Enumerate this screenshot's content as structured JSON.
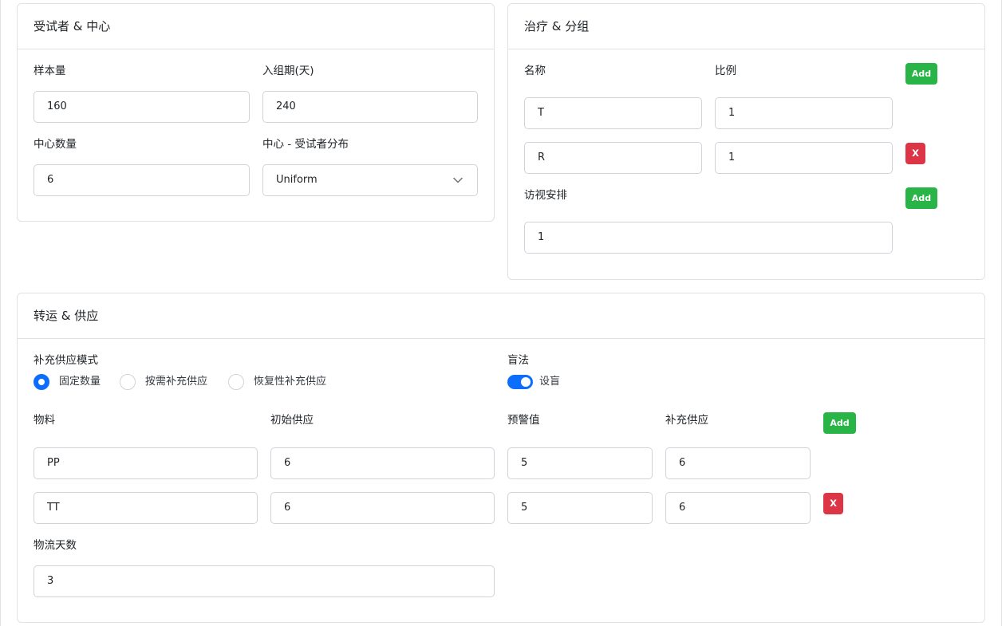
{
  "subjects_card": {
    "title": "受试者 & 中心",
    "sample_size": {
      "label": "样本量",
      "value": "160"
    },
    "enrollment_period": {
      "label": "入组期(天)",
      "value": "240"
    },
    "center_count": {
      "label": "中心数量",
      "value": "6"
    },
    "distribution": {
      "label": "中心 - 受试者分布",
      "value": "Uniform"
    }
  },
  "treatment_card": {
    "title": "治疗 & 分组",
    "name_header": "名称",
    "ratio_header": "比例",
    "add_label": "Add",
    "groups": [
      {
        "name": "T",
        "ratio": "1"
      },
      {
        "name": "R",
        "ratio": "1"
      }
    ],
    "remove_label": "X",
    "visits": {
      "label": "访视安排",
      "add_label": "Add",
      "value": "1"
    }
  },
  "supply_card": {
    "title": "转运 & 供应",
    "mode_label": "补充供应模式",
    "modes": [
      "固定数量",
      "按需补充供应",
      "恢复性补充供应"
    ],
    "selected_mode": "固定数量",
    "blind": {
      "label": "盲法",
      "toggle_label": "设盲",
      "enabled": true
    },
    "headers": {
      "material": "物料",
      "initial": "初始供应",
      "warning": "预警值",
      "resupply": "补充供应"
    },
    "add_label": "Add",
    "remove_label": "X",
    "rows": [
      {
        "material": "PP",
        "initial": "6",
        "warning": "5",
        "resupply": "6"
      },
      {
        "material": "TT",
        "initial": "6",
        "warning": "5",
        "resupply": "6"
      }
    ],
    "logistics_days": {
      "label": "物流天数",
      "value": "3"
    }
  },
  "colors": {
    "add": "#28b446",
    "remove": "#dc3545",
    "accent": "#0d6efd"
  }
}
